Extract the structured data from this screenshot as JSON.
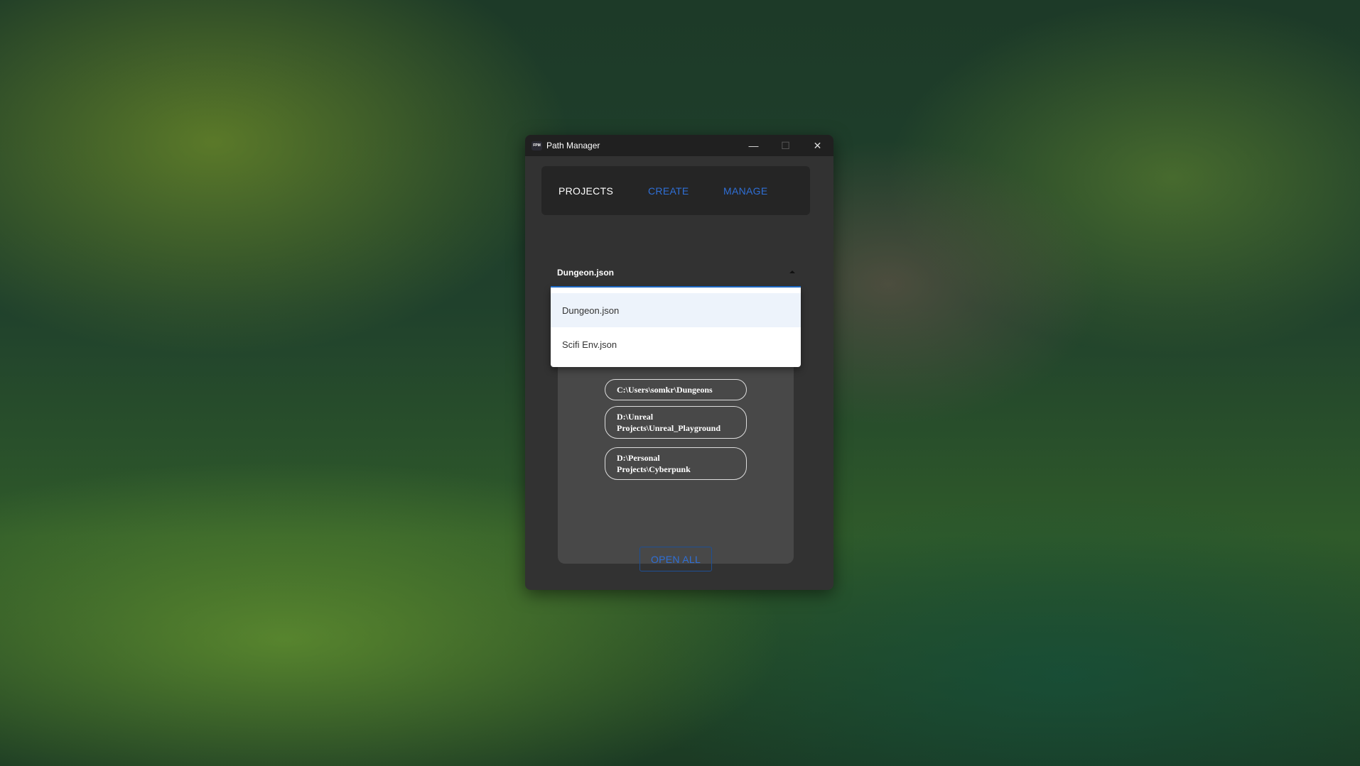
{
  "window": {
    "icon_text": "FPM",
    "title": "Path Manager",
    "minimize": "—",
    "maximize": "☐",
    "close": "✕"
  },
  "nav": {
    "tabs": [
      {
        "label": "PROJECTS",
        "active": true
      },
      {
        "label": "CREATE",
        "active": false
      },
      {
        "label": "MANAGE",
        "active": false
      }
    ]
  },
  "project_select": {
    "value": "Dungeon.json",
    "options": [
      "Dungeon.json",
      "Scifi Env.json"
    ]
  },
  "paths": [
    "C:\\Users\\somkr\\Dungeons",
    "D:\\Unreal Projects\\Unreal_Playground",
    "D:\\Personal Projects\\Cyberpunk"
  ],
  "open_all_label": "OPEN ALL",
  "colors": {
    "accent": "#2f6fd6",
    "window_bg": "#323232",
    "titlebar": "#202020"
  }
}
